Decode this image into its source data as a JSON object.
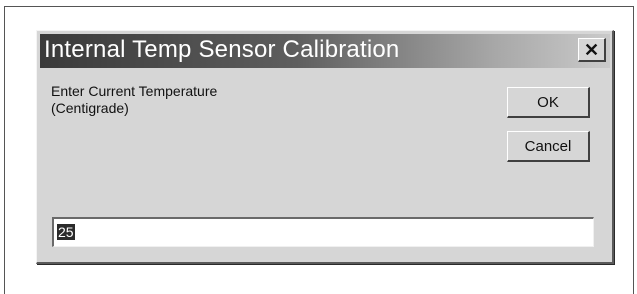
{
  "dialog": {
    "title": "Internal Temp Sensor Calibration",
    "close_label": "✕",
    "prompt_line1": "Enter Current Temperature",
    "prompt_line2": "(Centigrade)",
    "ok_label": "OK",
    "cancel_label": "Cancel",
    "input_value": "25"
  }
}
